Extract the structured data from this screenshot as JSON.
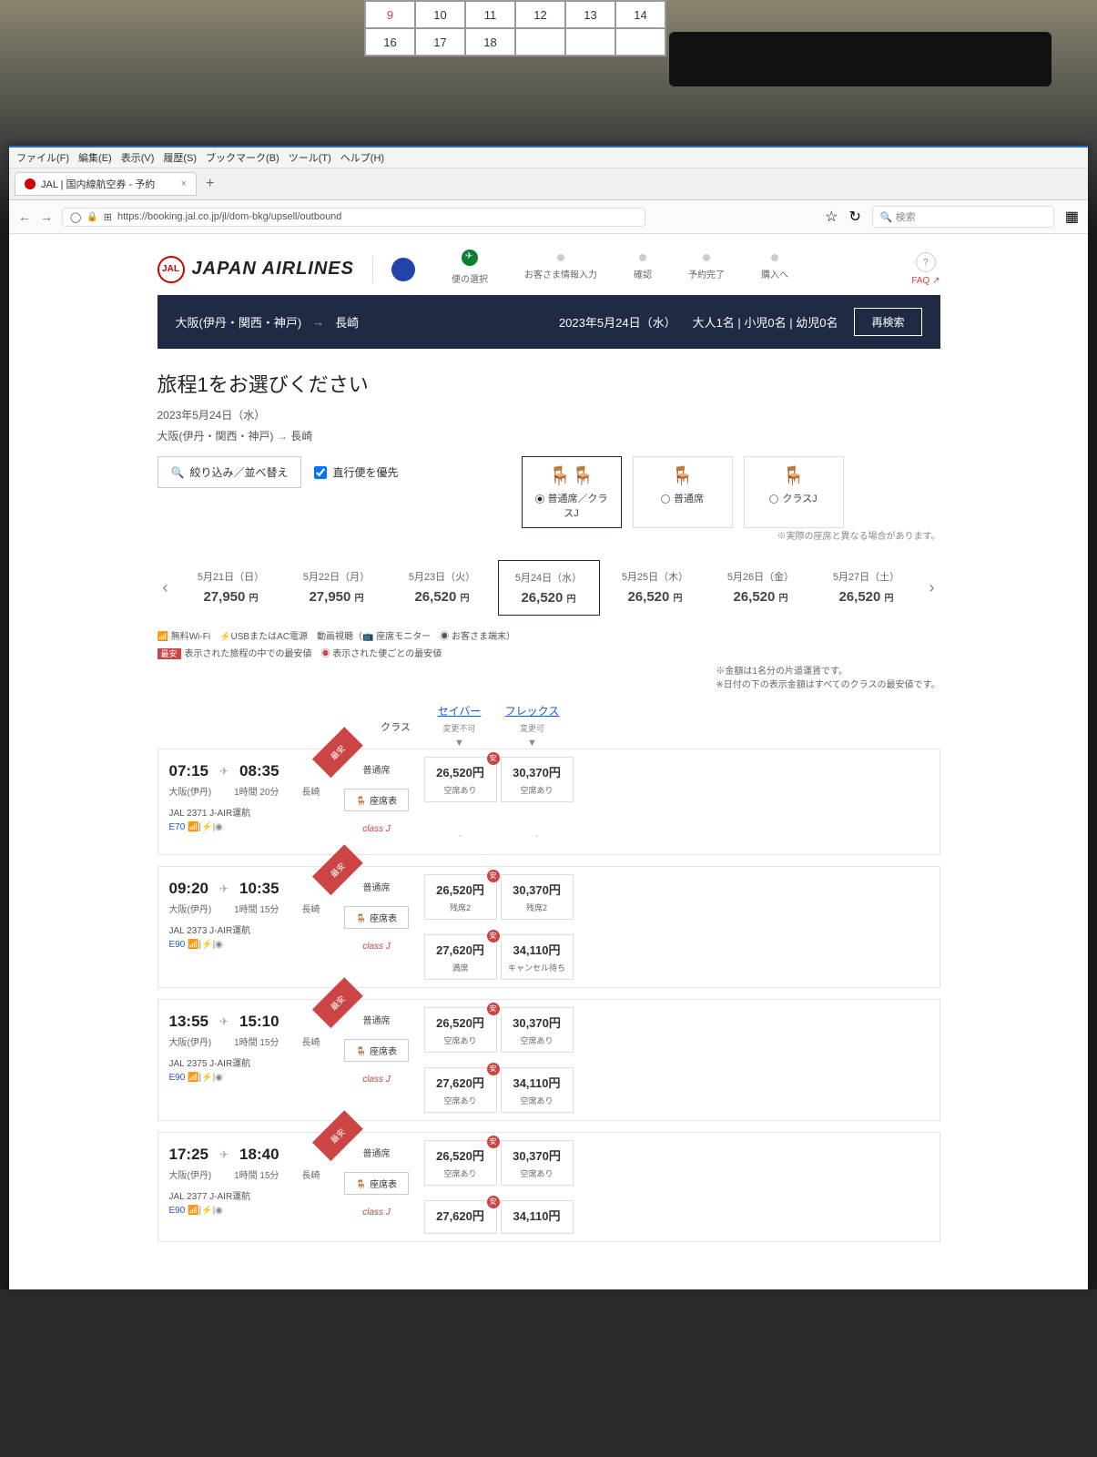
{
  "calendar": {
    "row1": [
      "9",
      "10",
      "11",
      "12",
      "13",
      "14"
    ],
    "row2": [
      "16",
      "17",
      "18",
      "",
      "",
      ""
    ]
  },
  "browser": {
    "menus": [
      "ファイル(F)",
      "編集(E)",
      "表示(V)",
      "履歴(S)",
      "ブックマーク(B)",
      "ツール(T)",
      "ヘルプ(H)"
    ],
    "tab_title": "JAL | 国内線航空券 - 予約",
    "url": "https://booking.jal.co.jp/jl/dom-bkg/upsell/outbound",
    "search_placeholder": "検索"
  },
  "header": {
    "brand": "JAPAN AIRLINES",
    "faq": "FAQ",
    "steps": [
      "便の選択",
      "お客さま情報入力",
      "確認",
      "予約完了",
      "購入へ"
    ]
  },
  "searchbar": {
    "origin": "大阪(伊丹・関西・神戸)",
    "dest": "長崎",
    "date": "2023年5月24日（水）",
    "pax": "大人1名 | 小児0名 | 幼児0名",
    "research": "再検索"
  },
  "page": {
    "title": "旅程1をお選びください",
    "date": "2023年5月24日（水）",
    "origin": "大阪(伊丹・関西・神戸)",
    "dest": "長崎",
    "filter": "絞り込み／並べ替え",
    "direct": "直行便を優先",
    "seat_note": "※実際の座席と異なる場合があります。",
    "seat_options": [
      "普通席／クラスJ",
      "普通席",
      "クラスJ"
    ]
  },
  "dates": [
    {
      "d": "5月21日（日）",
      "p": "27,950"
    },
    {
      "d": "5月22日（月）",
      "p": "27,950"
    },
    {
      "d": "5月23日（火）",
      "p": "26,520"
    },
    {
      "d": "5月24日（水）",
      "p": "26,520",
      "sel": true
    },
    {
      "d": "5月25日（木）",
      "p": "26,520"
    },
    {
      "d": "5月26日（金）",
      "p": "26,520"
    },
    {
      "d": "5月27日（土）",
      "p": "26,520"
    }
  ],
  "legend": {
    "line1": "無料Wi-Fi　⚡USBまたはAC電源　動画視聴（📺 座席モニター　◉ お客さま端末）",
    "badge": "最安",
    "line2a": "表示された旅程の中での最安値　",
    "line2b": "表示された便ごとの最安値",
    "right1": "※金額は1名分の片道運賃です。",
    "right2": "※日付の下の表示金額はすべてのクラスの最安値です。"
  },
  "fare_header": {
    "class": "クラス",
    "saver": "セイバー",
    "saver_sub": "変更不可",
    "flex": "フレックス",
    "flex_sub": "変更可"
  },
  "labels": {
    "economy": "普通席",
    "classj": "class J",
    "seatmap": "座席表",
    "yen": "円"
  },
  "flights": [
    {
      "dep": "07:15",
      "arr": "08:35",
      "from": "大阪(伊丹)",
      "to": "長崎",
      "dur": "1時間 20分",
      "no": "JAL 2371",
      "op": "J-AIR運航",
      "eq": "E70",
      "badge": true,
      "eco": [
        {
          "p": "26,520円",
          "s": "空席あり",
          "r": true
        },
        {
          "p": "30,370円",
          "s": "空席あり"
        }
      ],
      "cj": [
        {
          "dash": true
        },
        {
          "dash": true
        }
      ]
    },
    {
      "dep": "09:20",
      "arr": "10:35",
      "from": "大阪(伊丹)",
      "to": "長崎",
      "dur": "1時間 15分",
      "no": "JAL 2373",
      "op": "J-AIR運航",
      "eq": "E90",
      "badge": true,
      "eco": [
        {
          "p": "26,520円",
          "s": "残席2",
          "r": true
        },
        {
          "p": "30,370円",
          "s": "残席2"
        }
      ],
      "cj": [
        {
          "p": "27,620円",
          "s": "満席",
          "r": true
        },
        {
          "p": "34,110円",
          "s": "キャンセル待ち"
        }
      ]
    },
    {
      "dep": "13:55",
      "arr": "15:10",
      "from": "大阪(伊丹)",
      "to": "長崎",
      "dur": "1時間 15分",
      "no": "JAL 2375",
      "op": "J-AIR運航",
      "eq": "E90",
      "badge": true,
      "eco": [
        {
          "p": "26,520円",
          "s": "空席あり",
          "r": true
        },
        {
          "p": "30,370円",
          "s": "空席あり"
        }
      ],
      "cj": [
        {
          "p": "27,620円",
          "s": "空席あり",
          "r": true
        },
        {
          "p": "34,110円",
          "s": "空席あり"
        }
      ]
    },
    {
      "dep": "17:25",
      "arr": "18:40",
      "from": "大阪(伊丹)",
      "to": "長崎",
      "dur": "1時間 15分",
      "no": "JAL 2377",
      "op": "J-AIR運航",
      "eq": "E90",
      "badge": true,
      "eco": [
        {
          "p": "26,520円",
          "s": "空席あり",
          "r": true
        },
        {
          "p": "30,370円",
          "s": "空席あり"
        }
      ],
      "cj": [
        {
          "p": "27,620円",
          "s": "",
          "r": true
        },
        {
          "p": "34,110円",
          "s": ""
        }
      ]
    }
  ]
}
